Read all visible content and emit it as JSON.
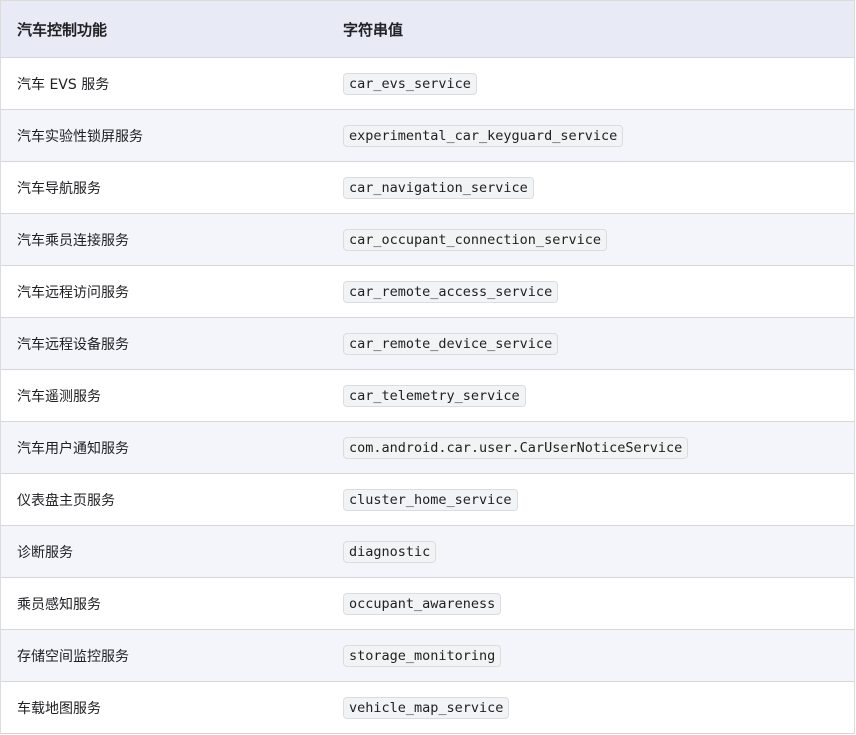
{
  "table": {
    "headers": {
      "name": "汽车控制功能",
      "value": "字符串值"
    },
    "rows": [
      {
        "name": "汽车 EVS 服务",
        "value": "car_evs_service"
      },
      {
        "name": "汽车实验性锁屏服务",
        "value": "experimental_car_keyguard_service"
      },
      {
        "name": "汽车导航服务",
        "value": "car_navigation_service"
      },
      {
        "name": "汽车乘员连接服务",
        "value": "car_occupant_connection_service"
      },
      {
        "name": "汽车远程访问服务",
        "value": "car_remote_access_service"
      },
      {
        "name": "汽车远程设备服务",
        "value": "car_remote_device_service"
      },
      {
        "name": "汽车遥测服务",
        "value": "car_telemetry_service"
      },
      {
        "name": "汽车用户通知服务",
        "value": "com.android.car.user.CarUserNoticeService"
      },
      {
        "name": "仪表盘主页服务",
        "value": "cluster_home_service"
      },
      {
        "name": "诊断服务",
        "value": "diagnostic"
      },
      {
        "name": "乘员感知服务",
        "value": "occupant_awareness"
      },
      {
        "name": "存储空间监控服务",
        "value": "storage_monitoring"
      },
      {
        "name": "车载地图服务",
        "value": "vehicle_map_service"
      }
    ]
  }
}
